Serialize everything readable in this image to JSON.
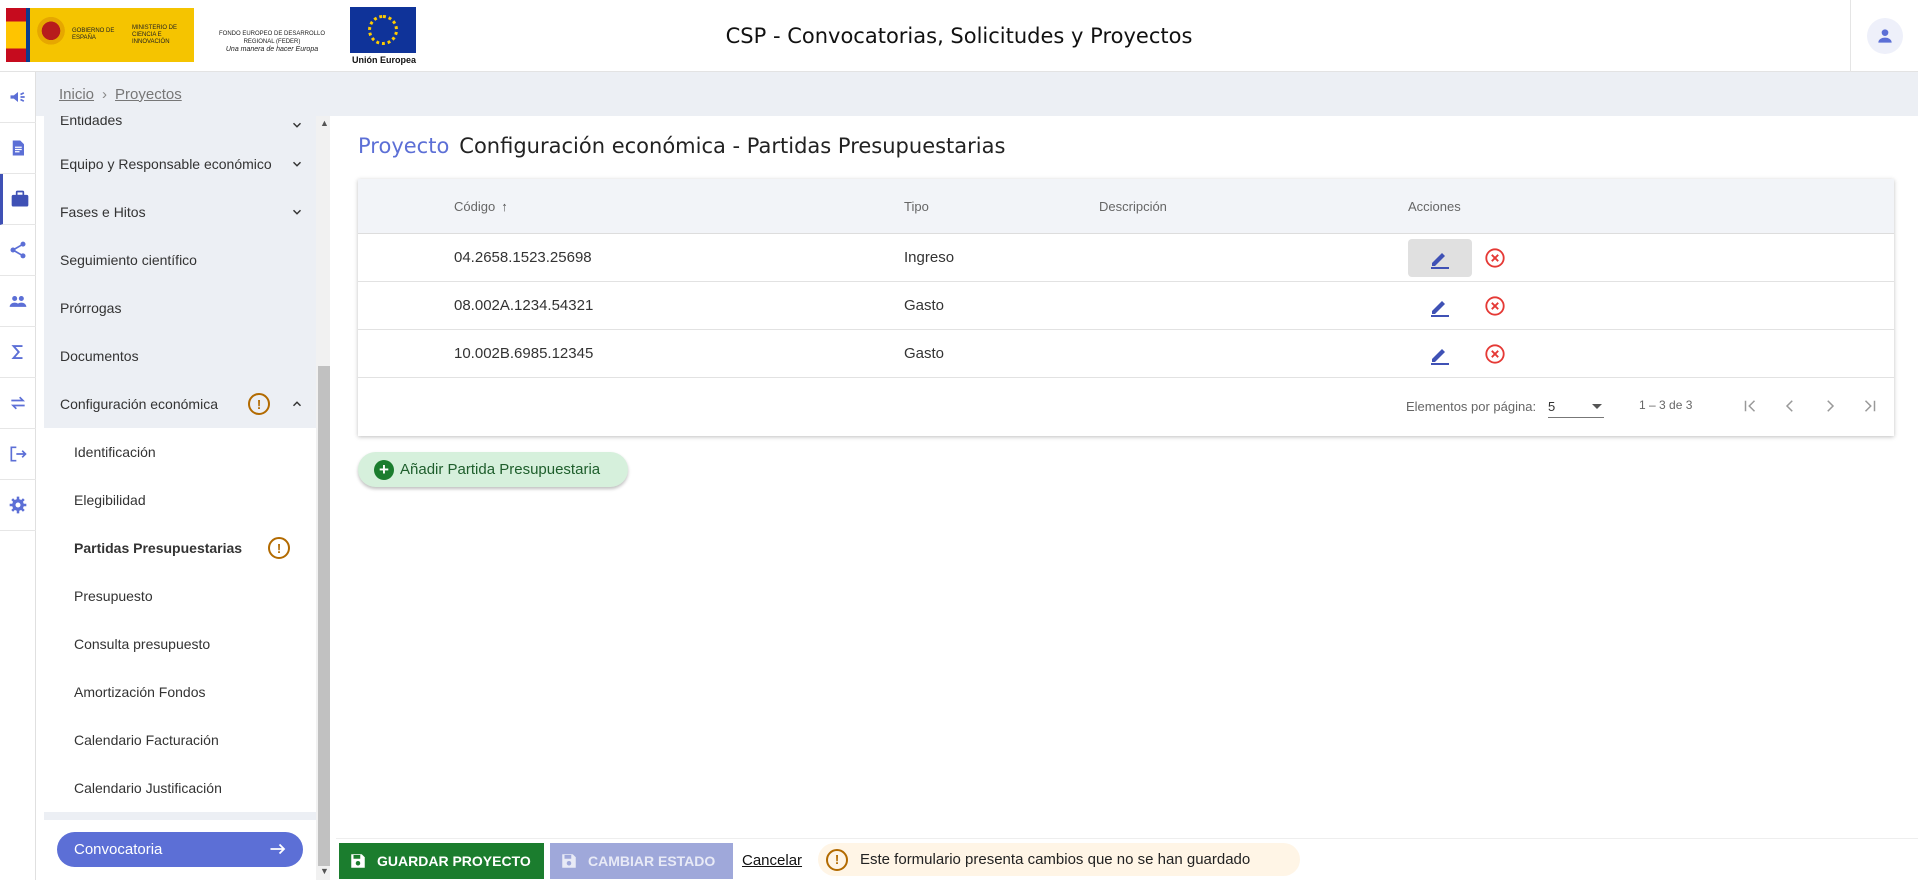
{
  "header": {
    "title": "CSP - Convocatorias, Solicitudes y Proyectos",
    "logo_gobierno_text": "GOBIERNO DE ESPAÑA",
    "logo_ministerio_text": "MINISTERIO DE CIENCIA E INNOVACIÓN",
    "logo_feder_line1": "FONDO EUROPEO DE DESARROLLO REGIONAL (FEDER)",
    "logo_feder_line2": "Una manera de hacer Europa",
    "logo_ue_text": "Unión Europea"
  },
  "rail": {
    "icons": [
      "megaphone-icon",
      "document-icon",
      "briefcase-icon",
      "share-icon",
      "people-icon",
      "sigma-icon",
      "swap-icon",
      "exit-icon",
      "gear-icon"
    ],
    "active_index": 2,
    "accent_color": "#3f51b5"
  },
  "breadcrumb": {
    "items": [
      "Inicio",
      "Proyectos"
    ]
  },
  "sidebar": {
    "items": [
      {
        "label": "Entidades",
        "chevron": "down"
      },
      {
        "label": "Equipo y Responsable económico",
        "chevron": "down"
      },
      {
        "label": "Fases e Hitos",
        "chevron": "down"
      },
      {
        "label": "Seguimiento científico"
      },
      {
        "label": "Prórrogas"
      },
      {
        "label": "Documentos"
      },
      {
        "label": "Configuración económica",
        "chevron": "up",
        "warning": true
      }
    ],
    "subitems": [
      {
        "label": "Identificación"
      },
      {
        "label": "Elegibilidad"
      },
      {
        "label": "Partidas Presupuestarias",
        "active": true,
        "warning": true
      },
      {
        "label": "Presupuesto"
      },
      {
        "label": "Consulta presupuesto"
      },
      {
        "label": "Amortización Fondos"
      },
      {
        "label": "Calendario Facturación"
      },
      {
        "label": "Calendario Justificación"
      }
    ],
    "convocatoria_button": "Convocatoria"
  },
  "main": {
    "title_entity": "Proyecto",
    "title": "Configuración económica - Partidas Presupuestarias",
    "table": {
      "columns": [
        "Código",
        "Tipo",
        "Descripción",
        "Acciones"
      ],
      "sorted_column": "Código",
      "sort_direction": "asc",
      "rows": [
        {
          "codigo": "04.2658.1523.25698",
          "tipo": "Ingreso",
          "descripcion": ""
        },
        {
          "codigo": "08.002A.1234.54321",
          "tipo": "Gasto",
          "descripcion": ""
        },
        {
          "codigo": "10.002B.6985.12345",
          "tipo": "Gasto",
          "descripcion": ""
        }
      ]
    },
    "paginator": {
      "label": "Elementos por página:",
      "page_size": "5",
      "range": "1 – 3 de 3"
    },
    "add_button": "Añadir Partida Presupuestaria"
  },
  "footer": {
    "save_button": "GUARDAR PROYECTO",
    "state_button": "CAMBIAR ESTADO",
    "cancel_link": "Cancelar",
    "unsaved_message": "Este formulario presenta cambios que no se han guardado"
  },
  "colors": {
    "primary": "#5c6fd6",
    "success": "#1b7d2e",
    "danger": "#e53935",
    "warning": "#b26a00"
  }
}
